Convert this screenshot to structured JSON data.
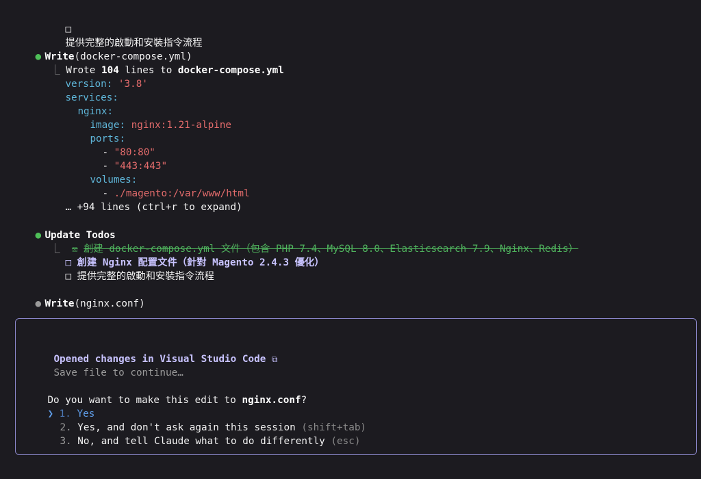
{
  "colors": {
    "background": "#1c1b20",
    "accent_green": "#4ebf58",
    "accent_purple": "#c8c3ff",
    "selection_blue": "#5f9de8",
    "yaml_key": "#5fb6d9",
    "yaml_value": "#e26b6b"
  },
  "top": {
    "checkbox_icon": "□",
    "pending_text": "提供完整的啟動和安裝指令流程"
  },
  "write1": {
    "bullet": "●",
    "tool": "Write",
    "arg": "(docker-compose.yml)",
    "result_elbow": "⎿",
    "result_prefix": "Wrote ",
    "result_count": "104",
    "result_mid": " lines to ",
    "result_file": "docker-compose.yml",
    "yaml": {
      "version_key": "version:",
      "version_val": "'3.8'",
      "services_key": "services:",
      "nginx_key": "nginx:",
      "image_key": "image:",
      "image_val": "nginx:1.21-alpine",
      "ports_key": "ports:",
      "dash": "-",
      "port1": "\"80:80\"",
      "port2": "\"443:443\"",
      "volumes_key": "volumes:",
      "volume1": "./magento:/var/www/html"
    },
    "more": "… +94 lines (ctrl+r to expand)"
  },
  "todos": {
    "bullet": "●",
    "title": "Update Todos",
    "elbow": "⎿",
    "items": [
      {
        "icon": "☒",
        "text": "創建 docker-compose.yml 文件（包含 PHP 7.4、MySQL 8.0、Elasticsearch 7.9、Nginx、Redis）",
        "state": "done"
      },
      {
        "icon": "□",
        "text": "創建 Nginx 配置文件（針對 Magento 2.4.3 優化）",
        "state": "active"
      },
      {
        "icon": "□",
        "text": "提供完整的啟動和安裝指令流程",
        "state": "pending"
      }
    ]
  },
  "write2": {
    "bullet": "●",
    "tool": "Write",
    "arg": "(nginx.conf)"
  },
  "dialog": {
    "title": "Opened changes in Visual Studio Code",
    "title_icon": "⧉",
    "subtitle": "Save file to continue…",
    "question_prefix": "Do you want to make this edit to ",
    "question_file": "nginx.conf",
    "question_suffix": "?",
    "pointer": "❯",
    "options": [
      {
        "num": "1.",
        "label": "Yes",
        "hint": ""
      },
      {
        "num": "2.",
        "label": "Yes, and don't ask again this session ",
        "hint": "(shift+tab)"
      },
      {
        "num": "3.",
        "label": "No, and tell Claude what to do differently ",
        "hint": "(esc)"
      }
    ]
  }
}
